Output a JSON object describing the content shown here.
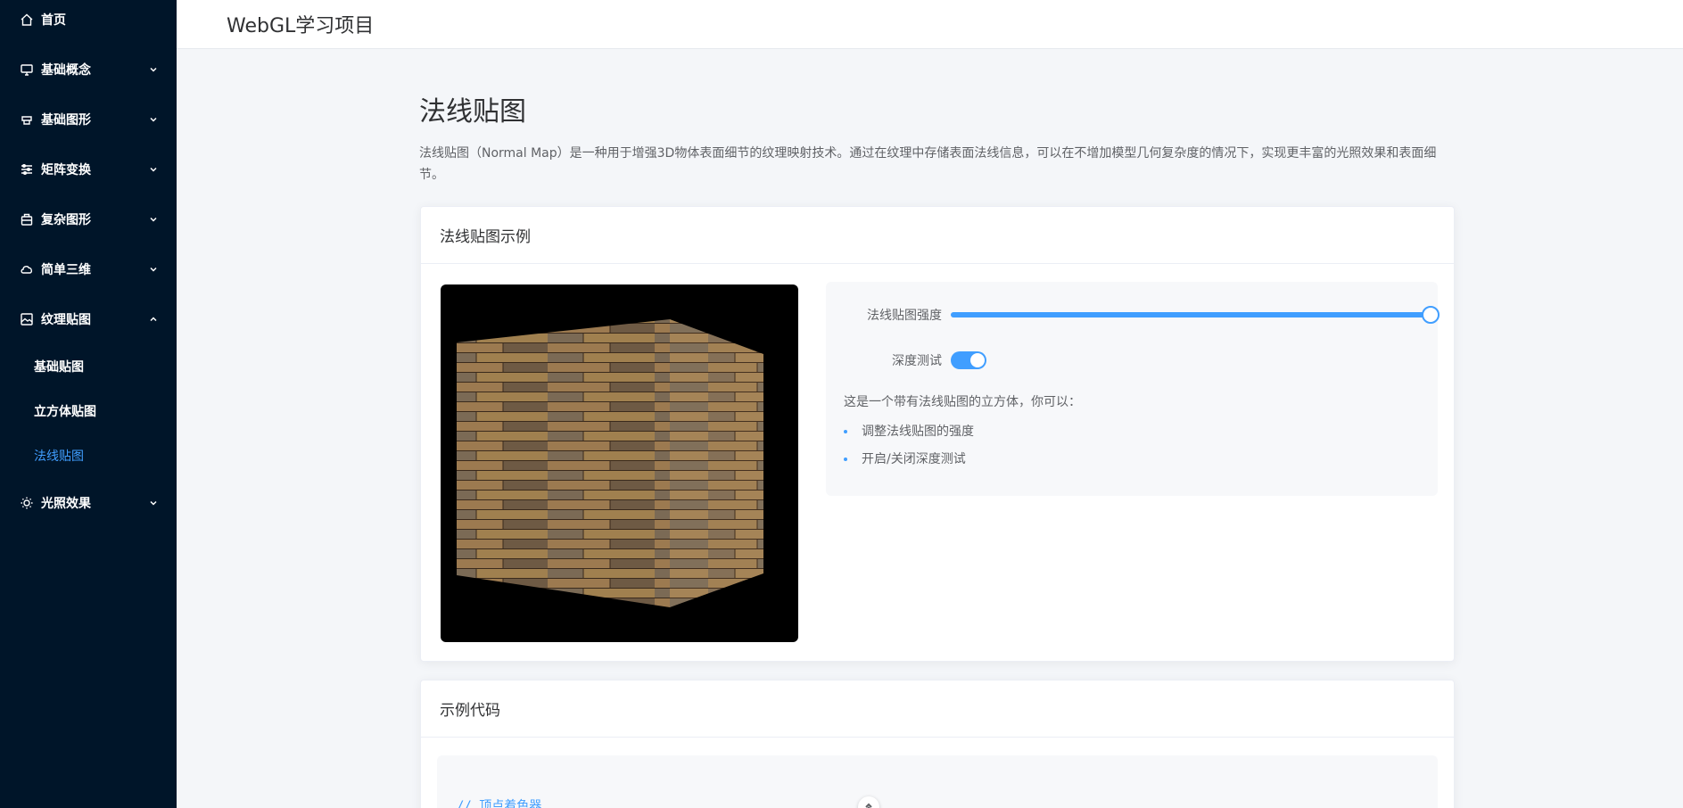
{
  "header": {
    "title": "WebGL学习项目"
  },
  "sidebar": {
    "items": [
      {
        "label": "首页",
        "icon": "home-icon",
        "has_children": false
      },
      {
        "label": "基础概念",
        "icon": "monitor-icon",
        "has_children": true,
        "expanded": false
      },
      {
        "label": "基础图形",
        "icon": "shapes-icon",
        "has_children": true,
        "expanded": false
      },
      {
        "label": "矩阵变换",
        "icon": "sliders-icon",
        "has_children": true,
        "expanded": false
      },
      {
        "label": "复杂图形",
        "icon": "box-icon",
        "has_children": true,
        "expanded": false
      },
      {
        "label": "简单三维",
        "icon": "cloud-icon",
        "has_children": true,
        "expanded": false
      },
      {
        "label": "纹理贴图",
        "icon": "picture-icon",
        "has_children": true,
        "expanded": true
      },
      {
        "label": "光照效果",
        "icon": "sun-icon",
        "has_children": true,
        "expanded": false
      }
    ],
    "texture_children": [
      {
        "label": "基础贴图",
        "active": false
      },
      {
        "label": "立方体贴图",
        "active": false
      },
      {
        "label": "法线贴图",
        "active": true
      }
    ]
  },
  "page": {
    "title": "法线贴图",
    "description": "法线贴图（Normal Map）是一种用于增强3D物体表面细节的纹理映射技术。通过在纹理中存储表面法线信息，可以在不增加模型几何复杂度的情况下，实现更丰富的光照效果和表面细节。"
  },
  "demo_card": {
    "title": "法线贴图示例",
    "controls": {
      "strength_label": "法线贴图强度",
      "strength_value": 1.0,
      "depth_label": "深度测试",
      "depth_enabled": true
    },
    "intro": "这是一个带有法线贴图的立方体，你可以：",
    "bullets": [
      "调整法线贴图的强度",
      "开启/关闭深度测试"
    ]
  },
  "code_card": {
    "title": "示例代码",
    "first_line": "// 顶点着色器"
  },
  "colors": {
    "sidebar_bg": "#001529",
    "accent": "#409eff",
    "page_bg": "#f4f6f9"
  }
}
